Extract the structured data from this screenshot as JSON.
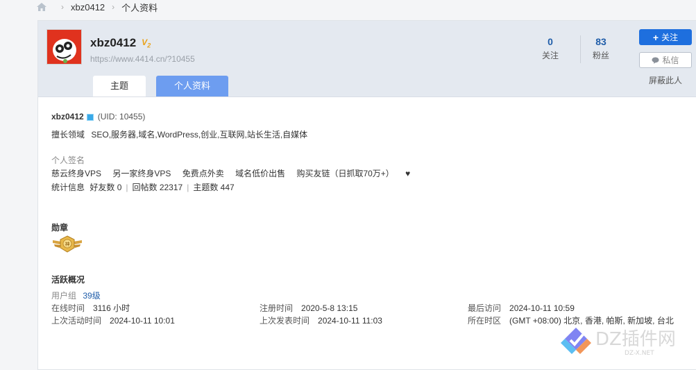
{
  "breadcrumb": {
    "user": "xbz0412",
    "page": "个人资料"
  },
  "profile": {
    "username": "xbz0412",
    "vip_level": "V",
    "vip_sub": "2",
    "url": "https://www.4414.cn/?10455"
  },
  "tabs": [
    {
      "label": "主题"
    },
    {
      "label": "个人资料"
    }
  ],
  "stats": {
    "following": {
      "value": "0",
      "label": "关注"
    },
    "fans": {
      "value": "83",
      "label": "粉丝"
    }
  },
  "actions": {
    "follow": "关注",
    "message": "私信",
    "block": "屏蔽此人"
  },
  "info": {
    "username": "xbz0412",
    "uid": "(UID: 10455)",
    "skill_label": "擅长领域",
    "skill_value": "SEO,服务器,域名,WordPress,创业,互联网,站长生活,自媒体",
    "signature_label": "个人签名",
    "signature_items": [
      "慈云终身VPS",
      "另一家终身VPS",
      "免费点外卖",
      "域名低价出售",
      "购买友链（日抓取70万+）"
    ],
    "heart": "♥",
    "stats_label": "统计信息",
    "friends": "好友数 0",
    "replies": "回帖数 22317",
    "topics": "主题数 447"
  },
  "medals": {
    "title": "勋章"
  },
  "activity": {
    "title": "活跃概况",
    "group_label": "用户组",
    "group_value": "39级",
    "online_label": "在线时间",
    "online_value": "3116 小时",
    "register_label": "注册时间",
    "register_value": "2020-5-8 13:15",
    "last_visit_label": "最后访问",
    "last_visit_value": "2024-10-11 10:59",
    "last_active_label": "上次活动时间",
    "last_active_value": "2024-10-11 10:01",
    "last_post_label": "上次发表时间",
    "last_post_value": "2024-10-11 11:03",
    "timezone_label": "所在时区",
    "timezone_value": "(GMT +08:00) 北京, 香港, 帕斯, 新加坡, 台北"
  },
  "watermark": {
    "brand": "DZ插件网",
    "sub": "DZ-X.NET"
  },
  "colors": {
    "accent": "#1e6fde",
    "tab_active": "#6d9df0",
    "header_bg": "#e4e9f0",
    "link": "#1f5da9"
  }
}
